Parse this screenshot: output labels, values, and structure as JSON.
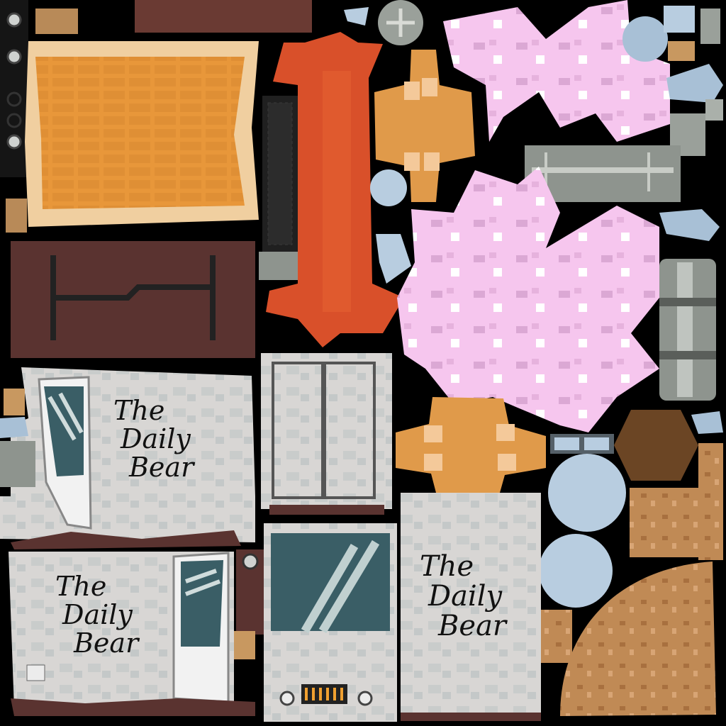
{
  "texture": {
    "signs": [
      {
        "line1": "The",
        "line2": "Daily",
        "line3": "Bear"
      },
      {
        "line1": "The",
        "line2": "Daily",
        "line3": "Bear"
      },
      {
        "line1": "The",
        "line2": "Daily",
        "line3": "Bear"
      }
    ],
    "colors": {
      "background": "#000000",
      "cardboard": "#e8973a",
      "rust_red": "#d9502a",
      "brown_wood": "#5a3330",
      "pink_fluff": "#f6c6ee",
      "van_grey": "#d8d6d4",
      "glass_blue": "#b8cde0",
      "metal_grey": "#9aa09a",
      "sand": "#c08a55",
      "window_teal": "#3a5e66"
    }
  }
}
